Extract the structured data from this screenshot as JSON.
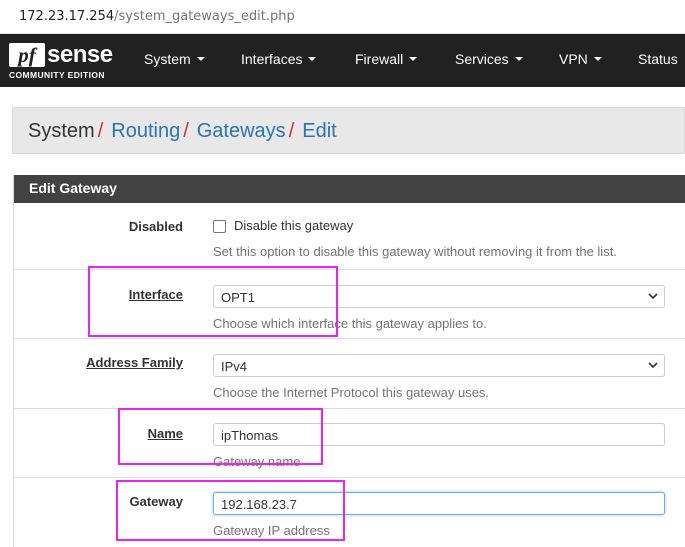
{
  "browser": {
    "url_host": "172.23.17.254",
    "url_path": "/system_gateways_edit.php"
  },
  "navbar": {
    "logo_pf": "pf",
    "logo_sense": "sense",
    "logo_edition": "COMMUNITY EDITION",
    "items": [
      {
        "label": "System"
      },
      {
        "label": "Interfaces"
      },
      {
        "label": "Firewall"
      },
      {
        "label": "Services"
      },
      {
        "label": "VPN"
      },
      {
        "label": "Status"
      }
    ]
  },
  "breadcrumb": {
    "items": [
      "System",
      "Routing",
      "Gateways",
      "Edit"
    ],
    "separator": "/"
  },
  "panel": {
    "title": "Edit Gateway",
    "fields": {
      "disabled": {
        "label": "Disabled",
        "checkbox_label": "Disable this gateway",
        "checked": false,
        "help": "Set this option to disable this gateway without removing it from the list."
      },
      "interface": {
        "label": "Interface",
        "value": "OPT1",
        "help": "Choose which interface this gateway applies to."
      },
      "address_family": {
        "label": "Address Family",
        "value": "IPv4",
        "help": "Choose the Internet Protocol this gateway uses."
      },
      "name": {
        "label": "Name",
        "value": "ipThomas",
        "help": "Gateway name"
      },
      "gateway": {
        "label": "Gateway",
        "value": "192.168.23.7",
        "help": "Gateway IP address"
      }
    }
  },
  "colors": {
    "navbar_bg": "#212121",
    "panel_heading_bg": "#424242",
    "link": "#2b73b8",
    "separator": "#c9302c",
    "annotation": "#ee22ee"
  }
}
